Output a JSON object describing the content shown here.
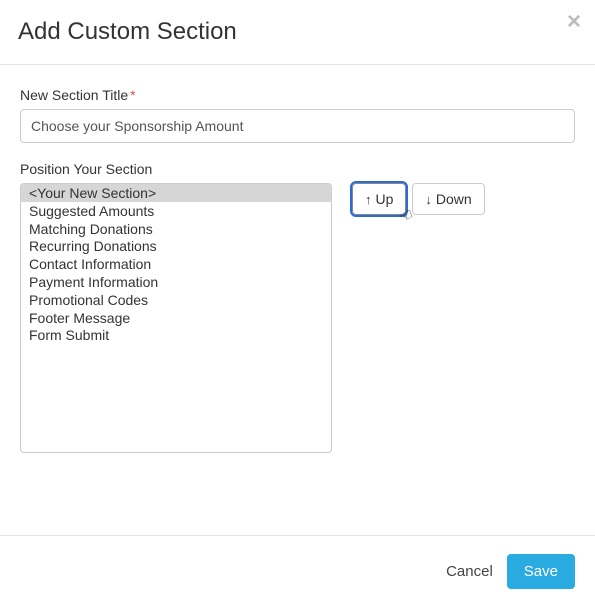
{
  "header": {
    "title": "Add Custom Section",
    "close_icon": "×"
  },
  "form": {
    "title_label": "New Section Title",
    "required_mark": "*",
    "title_value": "Choose your Sponsorship Amount",
    "position_label": "Position Your Section"
  },
  "sections": {
    "items": [
      {
        "label": "<Your New Section>",
        "selected": true
      },
      {
        "label": "Suggested Amounts",
        "selected": false
      },
      {
        "label": "Matching Donations",
        "selected": false
      },
      {
        "label": "Recurring Donations",
        "selected": false
      },
      {
        "label": "Contact Information",
        "selected": false
      },
      {
        "label": "Payment Information",
        "selected": false
      },
      {
        "label": "Promotional Codes",
        "selected": false
      },
      {
        "label": "Footer Message",
        "selected": false
      },
      {
        "label": "Form Submit",
        "selected": false
      }
    ]
  },
  "buttons": {
    "up_label": "Up",
    "down_label": "Down"
  },
  "footer": {
    "cancel_label": "Cancel",
    "save_label": "Save"
  }
}
